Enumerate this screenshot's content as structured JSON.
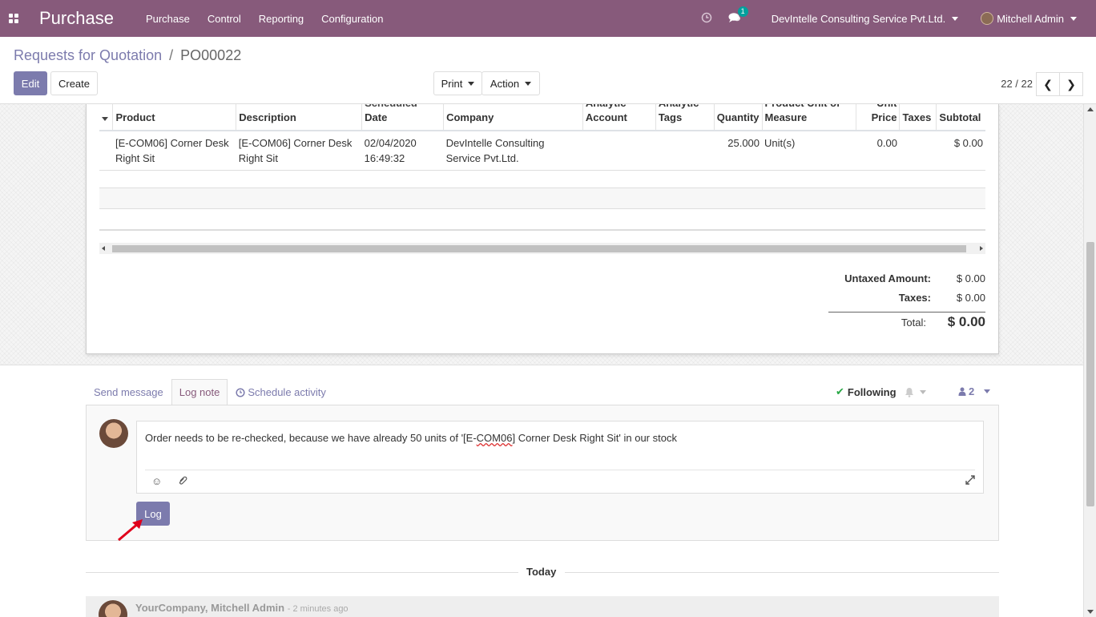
{
  "navbar": {
    "app_name": "Purchase",
    "menu": [
      "Purchase",
      "Control",
      "Reporting",
      "Configuration"
    ],
    "chat_count": "1",
    "company": "DevIntelle Consulting Service Pvt.Ltd.",
    "user": "Mitchell Admin",
    "icons": {
      "apps": "apps-grid-icon",
      "activity": "clock-icon",
      "chat": "chat-icon"
    }
  },
  "control": {
    "breadcrumb_parent": "Requests for Quotation",
    "breadcrumb_sep": "/",
    "breadcrumb_current": "PO00022",
    "edit_label": "Edit",
    "create_label": "Create",
    "print_label": "Print",
    "action_label": "Action",
    "pager": "22 / 22",
    "prev_icon": "❮",
    "next_icon": "❯"
  },
  "order_lines": {
    "headers": {
      "product": "Product",
      "description": "Description",
      "scheduled_date": [
        "Scheduled",
        "Date"
      ],
      "company": "Company",
      "analytic_account": [
        "Analytic",
        "Account"
      ],
      "analytic_tags": [
        "Analytic",
        "Tags"
      ],
      "quantity": "Quantity",
      "uom": [
        "Product Unit of",
        "Measure"
      ],
      "unit_price": [
        "Unit",
        "Price"
      ],
      "taxes": "Taxes",
      "subtotal": "Subtotal"
    },
    "rows": [
      {
        "product": [
          "[E-COM06] Corner Desk",
          "Right Sit"
        ],
        "description": [
          "[E-COM06] Corner Desk",
          "Right Sit"
        ],
        "scheduled_date": [
          "02/04/2020",
          "16:49:32"
        ],
        "company": [
          "DevIntelle Consulting",
          "Service Pvt.Ltd."
        ],
        "analytic_account": "",
        "analytic_tags": "",
        "quantity": "25.000",
        "uom": "Unit(s)",
        "unit_price": "0.00",
        "taxes": "",
        "subtotal": "$ 0.00"
      }
    ]
  },
  "totals": {
    "untaxed_label": "Untaxed Amount:",
    "untaxed_value": "$ 0.00",
    "taxes_label": "Taxes:",
    "taxes_value": "$ 0.00",
    "total_label": "Total:",
    "total_value": "$ 0.00"
  },
  "chatter": {
    "tabs": {
      "send_message": "Send message",
      "log_note": "Log note",
      "schedule_activity": "Schedule activity"
    },
    "following_label": "Following",
    "followers_count": "2",
    "note_text_before": "Order needs to be re-checked, because we have already 50 units of '[E-",
    "note_text_spell": "COM06",
    "note_text_after": "] Corner Desk Right Sit' in our stock",
    "log_button": "Log",
    "today_label": "Today",
    "message_author": "YourCompany, Mitchell Admin",
    "message_time": "- 2 minutes ago"
  },
  "colors": {
    "brand": "#875a7b",
    "primary": "#7c7bad",
    "success": "#28a745",
    "arrow": "#e0001b"
  }
}
